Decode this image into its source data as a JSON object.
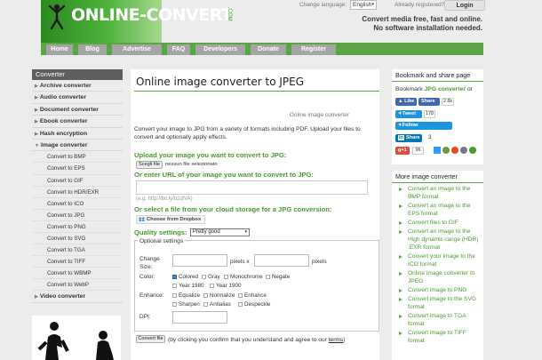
{
  "header": {
    "logo_part1": "ONLINE",
    "logo_dash": "-",
    "logo_part2": "CONVERT",
    "logo_suffix": ".COM",
    "change_language_label": "Change language:",
    "language_value": "English",
    "already_registered": "Already registered?",
    "login_label": "Login",
    "tagline_1": "Convert media free, fast and online.",
    "tagline_2": "No software installation needed."
  },
  "nav": [
    "Home",
    "Blog",
    "Advertise",
    "FAQ",
    "Developers",
    "Donate",
    "Register"
  ],
  "sidebar": {
    "title": "Converter",
    "items": [
      {
        "label": "Archive converter",
        "type": "item"
      },
      {
        "label": "Audio converter",
        "type": "item"
      },
      {
        "label": "Document converter",
        "type": "item"
      },
      {
        "label": "Ebook converter",
        "type": "item"
      },
      {
        "label": "Hash encryption",
        "type": "item"
      },
      {
        "label": "Image converter",
        "type": "item",
        "open": true
      },
      {
        "label": "Convert to BMP",
        "type": "sub"
      },
      {
        "label": "Convert to EPS",
        "type": "sub"
      },
      {
        "label": "Convert to GIF",
        "type": "sub"
      },
      {
        "label": "Convert to HDR/EXR",
        "type": "sub"
      },
      {
        "label": "Convert to ICO",
        "type": "sub"
      },
      {
        "label": "Convert to JPG",
        "type": "sub"
      },
      {
        "label": "Convert to PNG",
        "type": "sub"
      },
      {
        "label": "Convert to SVG",
        "type": "sub"
      },
      {
        "label": "Convert to TGA",
        "type": "sub"
      },
      {
        "label": "Convert to TIFF",
        "type": "sub"
      },
      {
        "label": "Convert to WBMP",
        "type": "sub"
      },
      {
        "label": "Convert to WebP",
        "type": "sub"
      },
      {
        "label": "Video converter",
        "type": "item"
      }
    ]
  },
  "main": {
    "title": "Online image converter to JPEG",
    "subtitle": "Online image converter",
    "description": "Convert your image to JPG from a variety of formats including PDF. Upload your files to convert and optionally apply effects.",
    "upload_heading": "Upload your image you want to convert to JPG:",
    "choose_file_label": "Scegli file",
    "no_file_text": "nessun file selezionato",
    "url_heading": "Or enter URL of your image you want to convert to JPG:",
    "url_placeholder": "(e.g. http://bit.ly/b2dlVA)",
    "cloud_heading": "Or select a file from your cloud storage for a JPG conversion:",
    "dropbox_label": "Choose from Dropbox",
    "quality_label": "Quality settings:",
    "quality_value": "Pretty good",
    "optional_legend": "Optional settings",
    "change_size_label": "Change Size:",
    "pixels_x": "pixels x",
    "pixels": "pixels",
    "color_label": "Color:",
    "color_options": [
      "Colored",
      "Gray",
      "Monochrome",
      "Negate",
      "Year 1980",
      "Year 1900"
    ],
    "enhance_label": "Enhance:",
    "enhance_options": [
      "Equalize",
      "Normalize",
      "Enhance",
      "Sharpen",
      "Antialias",
      "Despeckle"
    ],
    "dpi_label": "DPI:",
    "convert_button": "Convert file",
    "footer_text": "(by clicking you confirm that you understand and agree to our",
    "terms_link": "terms",
    "footer_end": ")"
  },
  "bookmark": {
    "title": "Bookmark and share page",
    "text_prefix": "Bookmark",
    "text_bold": "JPG converter",
    "text_suffix": "or",
    "like": "Like",
    "share": "Share",
    "fb_count": "2.8k",
    "tweet": "Tweet",
    "tweet_count": "178",
    "follow": "Follow @onlineconvert",
    "in_share": "Share",
    "in_count": "3",
    "gplus_count": "96"
  },
  "more": {
    "title": "More image converter",
    "items": [
      "Convert an image to the BMP format",
      "Convert an image to the EPS format",
      "Convert files to GIF",
      "Convert an image to the High dynamic-range (HDR) .EXR format",
      "Convert your image to the ICO format",
      "Online image converter to JPEG",
      "Convert image to PNG",
      "Convert image to the SVG format",
      "Convert image to TGA format",
      "Convert image to TIFF format"
    ]
  },
  "colors": {
    "brand_green": "#5aa646",
    "link_green": "#4a9a2f",
    "nav_tab": "#a5a5a5"
  }
}
